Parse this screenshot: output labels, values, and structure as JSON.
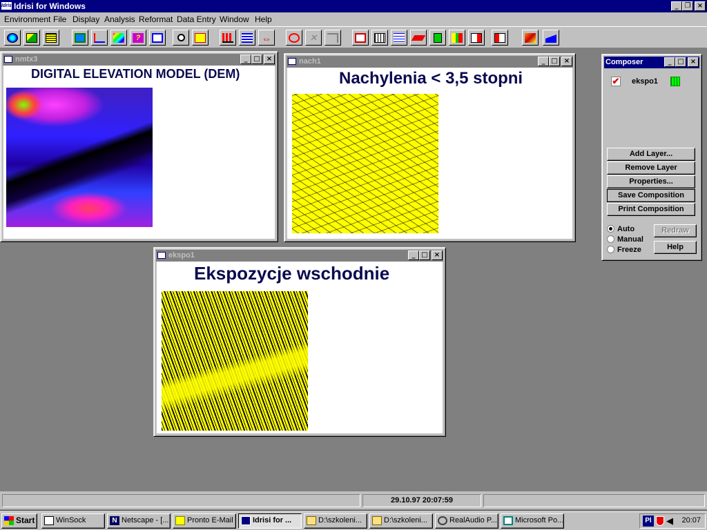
{
  "app": {
    "title": "Idrisi for Windows",
    "icon_text": "Idrisi"
  },
  "menu": [
    "Environment",
    "File",
    "Display",
    "Analysis",
    "Reformat",
    "Data Entry",
    "Window",
    "Help"
  ],
  "caption_buttons": {
    "minimize": "_",
    "maximize": "□",
    "close": "×",
    "restore": "❐"
  },
  "windows": {
    "nmtx3": {
      "name": "nmtx3",
      "title": "DIGITAL ELEVATION MODEL (DEM)"
    },
    "nach1": {
      "name": "nach1",
      "title": "Nachylenia < 3,5 stopni"
    },
    "ekspo1": {
      "name": "ekspo1",
      "title": "Ekspozycje wschodnie"
    }
  },
  "composer": {
    "title": "Composer",
    "layer": "ekspo1",
    "buttons": [
      "Add Layer...",
      "Remove Layer",
      "Properties...",
      "Save Composition",
      "Print Composition"
    ],
    "radios": [
      {
        "label": "Auto",
        "checked": true
      },
      {
        "label": "Manual",
        "checked": false
      },
      {
        "label": "Freeze",
        "checked": false
      }
    ],
    "redraw": "Redraw",
    "help": "Help"
  },
  "status": {
    "datetime": "29.10.97 20:07:59"
  },
  "taskbar": {
    "start": "Start",
    "tasks": [
      "WinSock",
      "Netscape - [...",
      "Pronto E-Mail",
      "Idrisi for ...",
      "D:\\szkoleni...",
      "D:\\szkoleni...",
      "RealAudio P...",
      "Microsoft Po..."
    ],
    "lang": "Pl",
    "clock": "20:07"
  },
  "colors": {
    "titlebar_active": "#000080",
    "titlebar_inactive": "#808080",
    "face": "#c0c0c0",
    "desktop": "#808080",
    "map_yellow": "#ffff00"
  }
}
